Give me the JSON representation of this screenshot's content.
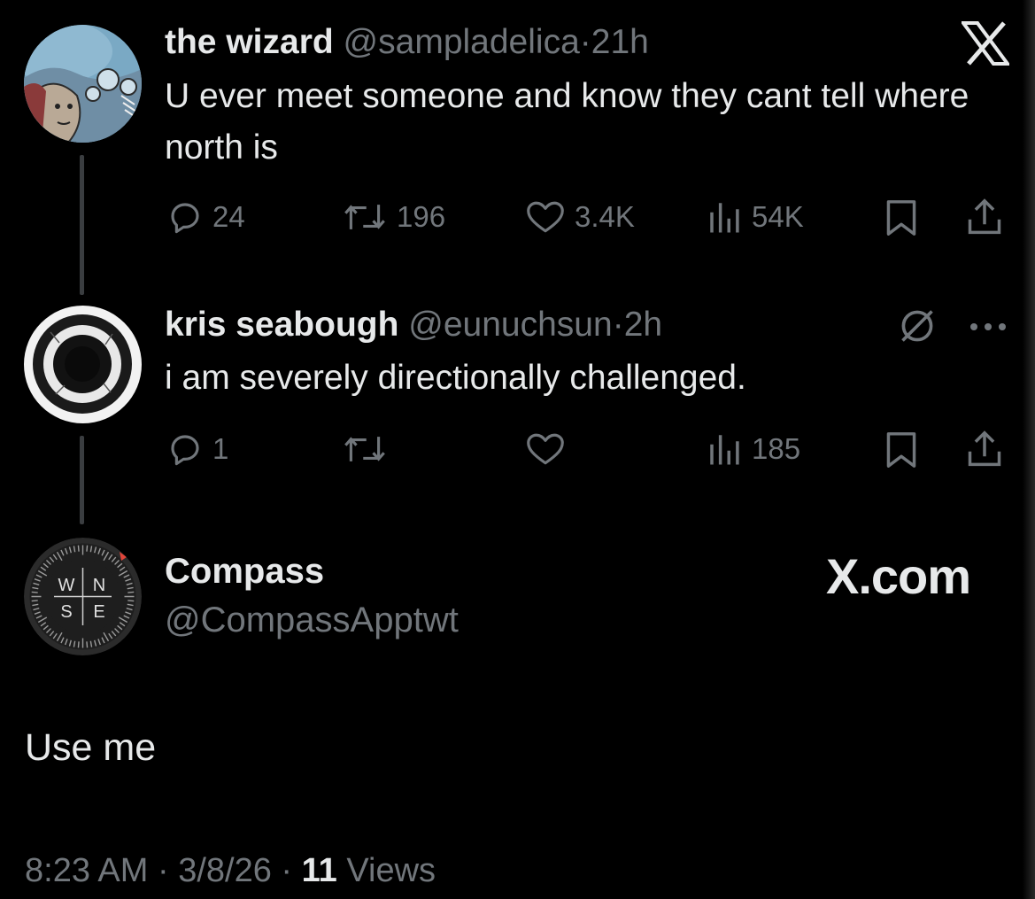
{
  "tweets": [
    {
      "name": "the wizard",
      "handle": "@sampladelica",
      "separator": "·",
      "time": "21h",
      "text": "U ever meet someone and know they cant tell where north is",
      "replies": "24",
      "retweets": "196",
      "likes": "3.4K",
      "views": "54K"
    },
    {
      "name": "kris seabough",
      "handle": "@eunuchsun",
      "separator": "·",
      "time": "2h",
      "text": "i am severely directionally challenged.",
      "replies": "1",
      "retweets": "",
      "likes": "",
      "views": "185"
    }
  ],
  "main_post": {
    "name": "Compass",
    "handle": "@CompassApptwt",
    "site_label": "X.com",
    "text": "Use me",
    "compass_letters": [
      "W",
      "N",
      "S",
      "E"
    ],
    "footer_time": "8:23 AM",
    "footer_sep1": " · ",
    "footer_date": "3/8/26",
    "footer_sep2": " · ",
    "footer_views_count": "11",
    "footer_views_label": " Views"
  },
  "icons": {
    "reply": "reply-icon",
    "retweet": "retweet-icon",
    "like": "heart-icon",
    "views": "views-bar-chart-icon",
    "bookmark": "bookmark-icon",
    "share": "share-icon",
    "x_logo": "x-logo-icon",
    "hide": "hide-icon",
    "more": "more-icon"
  },
  "colors": {
    "background": "#000000",
    "text": "#e7e9ea",
    "muted": "#71767b",
    "thread_line": "#3a3d40"
  }
}
